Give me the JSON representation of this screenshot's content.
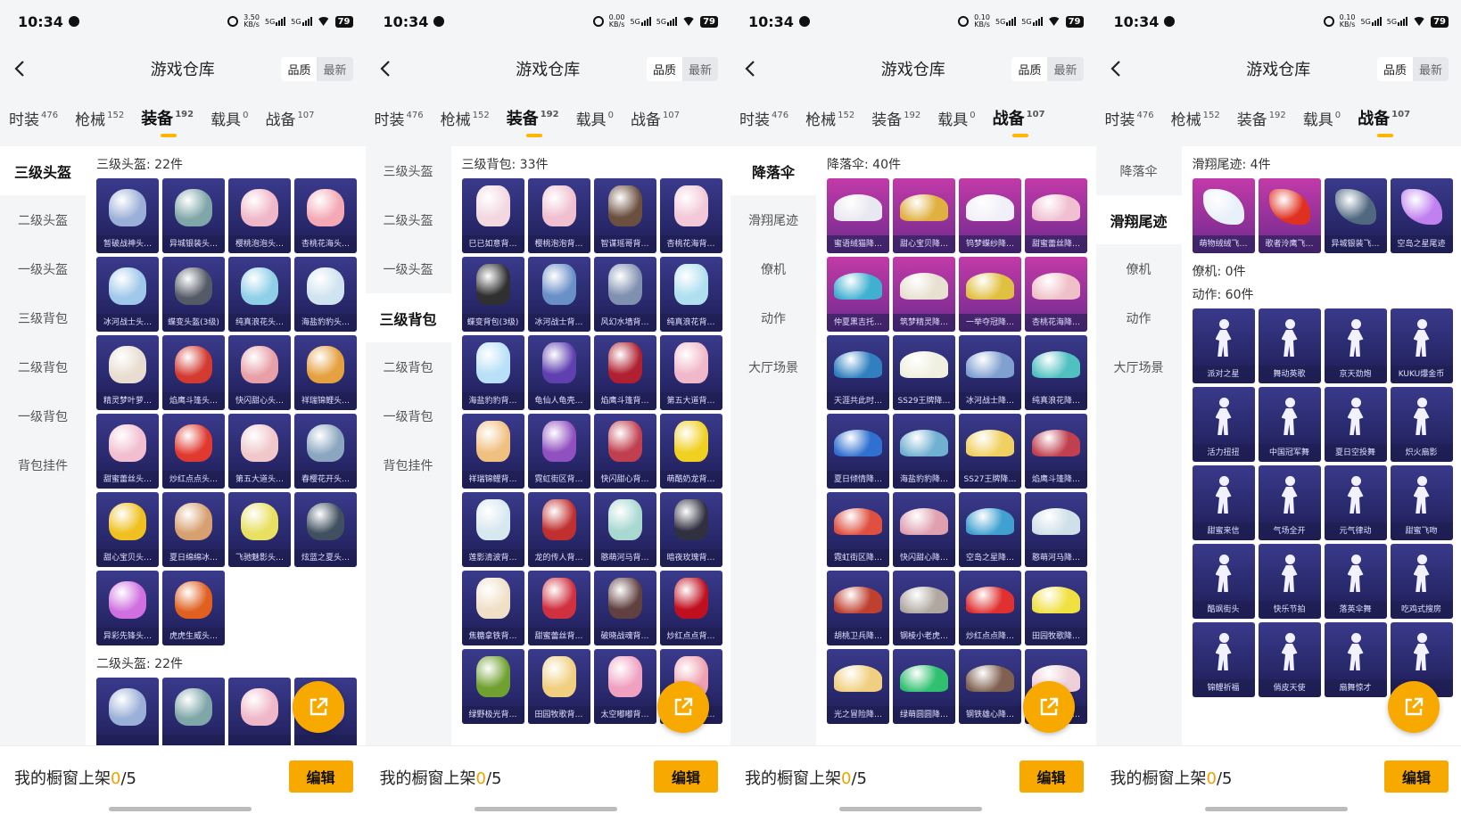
{
  "colors": {
    "accent": "#f7a900",
    "card_dark": "#2b2b70",
    "card_pink": "#b2379e"
  },
  "panels": [
    {
      "status": {
        "time": "10:34",
        "net_top": "3.50",
        "net_bottom": "KB/s",
        "sig1": "5G",
        "sig2": "5G",
        "battery": "79"
      },
      "header": {
        "title": "游戏仓库",
        "sort_quality": "品质",
        "sort_latest": "最新"
      },
      "tabs": [
        {
          "label": "时装",
          "count": "476"
        },
        {
          "label": "枪械",
          "count": "152"
        },
        {
          "label": "装备",
          "count": "192"
        },
        {
          "label": "载具",
          "count": "0"
        },
        {
          "label": "战备",
          "count": "107"
        }
      ],
      "active_tab": 2,
      "sidebar": [
        "三级头盔",
        "二级头盔",
        "一级头盔",
        "三级背包",
        "二级背包",
        "一级背包",
        "背包挂件"
      ],
      "active_side": 0,
      "sections": [
        {
          "title": "三级头盔: 22件",
          "kind": "helmet",
          "items": [
            "暂破战神头…",
            "异城银装头…",
            "樱桃泡泡头…",
            "杏桃花海头…",
            "冰河战士头…",
            "蝶变头盔(3级)",
            "纯真浪花头…",
            "海盐豹豹头…",
            "精灵梦叶萝…",
            "焰鹰斗篷头…",
            "快闪甜心头…",
            "祥瑞锦鲤头…",
            "甜蜜蕾丝头…",
            "炒红点点头…",
            "第五大道头…",
            "春樱花开头…",
            "甜心宝贝头…",
            "夏日绵绵冰…",
            "飞驰魅影头…",
            "炫蓝之夏头…",
            "异彩先锋头…",
            "虎虎生威头…"
          ]
        },
        {
          "title": "二级头盔: 22件",
          "kind": "helmet",
          "items": [
            "",
            "",
            "",
            ""
          ]
        }
      ],
      "footer": {
        "prefix": "我的橱窗上架",
        "num": "0",
        "suffix": "/5",
        "edit": "编辑"
      }
    },
    {
      "status": {
        "time": "10:34",
        "net_top": "0.00",
        "net_bottom": "KB/s",
        "sig1": "5G",
        "sig2": "5G",
        "battery": "79"
      },
      "header": {
        "title": "游戏仓库",
        "sort_quality": "品质",
        "sort_latest": "最新"
      },
      "tabs": [
        {
          "label": "时装",
          "count": "476"
        },
        {
          "label": "枪械",
          "count": "152"
        },
        {
          "label": "装备",
          "count": "192"
        },
        {
          "label": "载具",
          "count": "0"
        },
        {
          "label": "战备",
          "count": "107"
        }
      ],
      "active_tab": 2,
      "sidebar": [
        "三级头盔",
        "二级头盔",
        "一级头盔",
        "三级背包",
        "二级背包",
        "一级背包",
        "背包挂件"
      ],
      "active_side": 3,
      "sections": [
        {
          "title": "三级背包: 33件",
          "kind": "bag",
          "items": [
            "巳已如意背…",
            "樱桃泡泡背…",
            "智谋瑶哥背…",
            "杏桃花海背…",
            "蝶变背包(3级)",
            "冰河战士背…",
            "风幻水墙背…",
            "纯真浪花背…",
            "海盐豹豹背…",
            "龟仙人龟壳…",
            "焰鹰斗篷背…",
            "第五大道背…",
            "祥瑞锦鲤背…",
            "霓虹街区背…",
            "快闪甜心背…",
            "萌酷奶龙背…",
            "莲影清波背…",
            "龙的传人背…",
            "憨萌河马背…",
            "暗夜玫瑰背…",
            "焦糖拿铁背…",
            "甜蜜蕾丝背…",
            "破晓战魂背…",
            "炒红点点背…",
            "绿野极光背…",
            "田园牧歌背…",
            "太空嘟嘟背…",
            "甜心蛋梦背…"
          ]
        }
      ],
      "footer": {
        "prefix": "我的橱窗上架",
        "num": "0",
        "suffix": "/5",
        "edit": "编辑"
      }
    },
    {
      "status": {
        "time": "10:34",
        "net_top": "0.10",
        "net_bottom": "KB/s",
        "sig1": "5G",
        "sig2": "5G",
        "battery": "79"
      },
      "header": {
        "title": "游戏仓库",
        "sort_quality": "品质",
        "sort_latest": "最新"
      },
      "tabs": [
        {
          "label": "时装",
          "count": "476"
        },
        {
          "label": "枪械",
          "count": "152"
        },
        {
          "label": "装备",
          "count": "192"
        },
        {
          "label": "载具",
          "count": "0"
        },
        {
          "label": "战备",
          "count": "107"
        }
      ],
      "active_tab": 4,
      "sidebar": [
        "降落伞",
        "滑翔尾迹",
        "僚机",
        "动作",
        "大厅场景"
      ],
      "active_side": 0,
      "sections": [
        {
          "title": "降落伞: 40件",
          "kind": "chute",
          "pink_count": 8,
          "items": [
            "蜜语绒猫降…",
            "甜心宝贝降…",
            "钨梦蝶纱降…",
            "甜蜜蕾丝降…",
            "仲夏黑吉托…",
            "筑梦精灵降…",
            "一举夺冠降…",
            "杏桃花海降…",
            "天涯共此时…",
            "SS29王牌降…",
            "冰河战士降…",
            "纯真浪花降…",
            "夏日倾情降…",
            "海盐豹豹降…",
            "SS27王牌降…",
            "焰鹰斗篷降…",
            "霓虹街区降…",
            "快闪甜心降…",
            "空岛之星降…",
            "憨萌河马降…",
            "胡桃卫兵降…",
            "钢棱小老虎…",
            "炒红点点降…",
            "田园牧歌降…",
            "光之冒险降…",
            "绿萌圆圆降…",
            "钢铁雄心降…",
            "娇憨猪猪降…"
          ]
        }
      ],
      "footer": {
        "prefix": "我的橱窗上架",
        "num": "0",
        "suffix": "/5",
        "edit": "编辑"
      }
    },
    {
      "status": {
        "time": "10:34",
        "net_top": "0.10",
        "net_bottom": "KB/s",
        "sig1": "5G",
        "sig2": "5G",
        "battery": "79"
      },
      "header": {
        "title": "游戏仓库",
        "sort_quality": "品质",
        "sort_latest": "最新"
      },
      "tabs": [
        {
          "label": "时装",
          "count": "476"
        },
        {
          "label": "枪械",
          "count": "152"
        },
        {
          "label": "装备",
          "count": "192"
        },
        {
          "label": "载具",
          "count": "0"
        },
        {
          "label": "战备",
          "count": "107"
        }
      ],
      "active_tab": 4,
      "sidebar": [
        "降落伞",
        "滑翔尾迹",
        "僚机",
        "动作",
        "大厅场景"
      ],
      "active_side": 1,
      "sections": [
        {
          "title": "滑翔尾迹: 4件",
          "kind": "trail",
          "pink_count": 2,
          "items": [
            "萌物绒绒飞…",
            "歌者泠鹰飞…",
            "异城银装飞…",
            "空岛之星尾迹"
          ]
        },
        {
          "title": "僚机: 0件",
          "kind": "trail",
          "items": []
        },
        {
          "title": "动作: 60件",
          "kind": "act",
          "items": [
            "派对之星",
            "舞动英歌",
            "京天劲炮",
            "KUKU爆金币",
            "活力扭扭",
            "中国冠军舞",
            "夏日空投舞",
            "炽火扇影",
            "甜蜜来信",
            "气场全开",
            "元气律动",
            "甜蜜飞吻",
            "酷飒街头",
            "快乐节拍",
            "落英伞舞",
            "吃鸡式搜房",
            "锦鲤祈福",
            "俏皮天使",
            "扇舞惊才",
            ""
          ]
        }
      ],
      "footer": {
        "prefix": "我的橱窗上架",
        "num": "0",
        "suffix": "/5",
        "edit": "编辑"
      }
    }
  ]
}
